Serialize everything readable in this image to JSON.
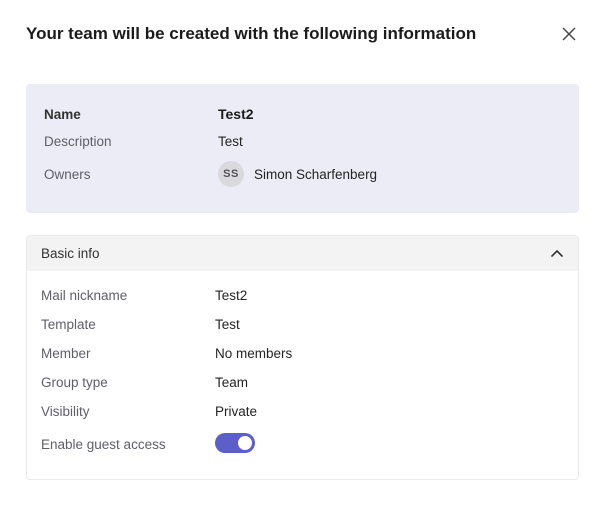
{
  "header": {
    "title": "Your team will be created with the following information"
  },
  "summary": {
    "name_label": "Name",
    "name_value": "Test2",
    "description_label": "Description",
    "description_value": "Test",
    "owners_label": "Owners",
    "owner_initials": "SS",
    "owner_name": "Simon Scharfenberg"
  },
  "section": {
    "title": "Basic info",
    "rows": {
      "mail_nickname_label": "Mail nickname",
      "mail_nickname_value": "Test2",
      "template_label": "Template",
      "template_value": "Test",
      "member_label": "Member",
      "member_value": "No members",
      "group_type_label": "Group type",
      "group_type_value": "Team",
      "visibility_label": "Visibility",
      "visibility_value": "Private",
      "guest_access_label": "Enable guest access",
      "guest_access_on": true
    }
  }
}
